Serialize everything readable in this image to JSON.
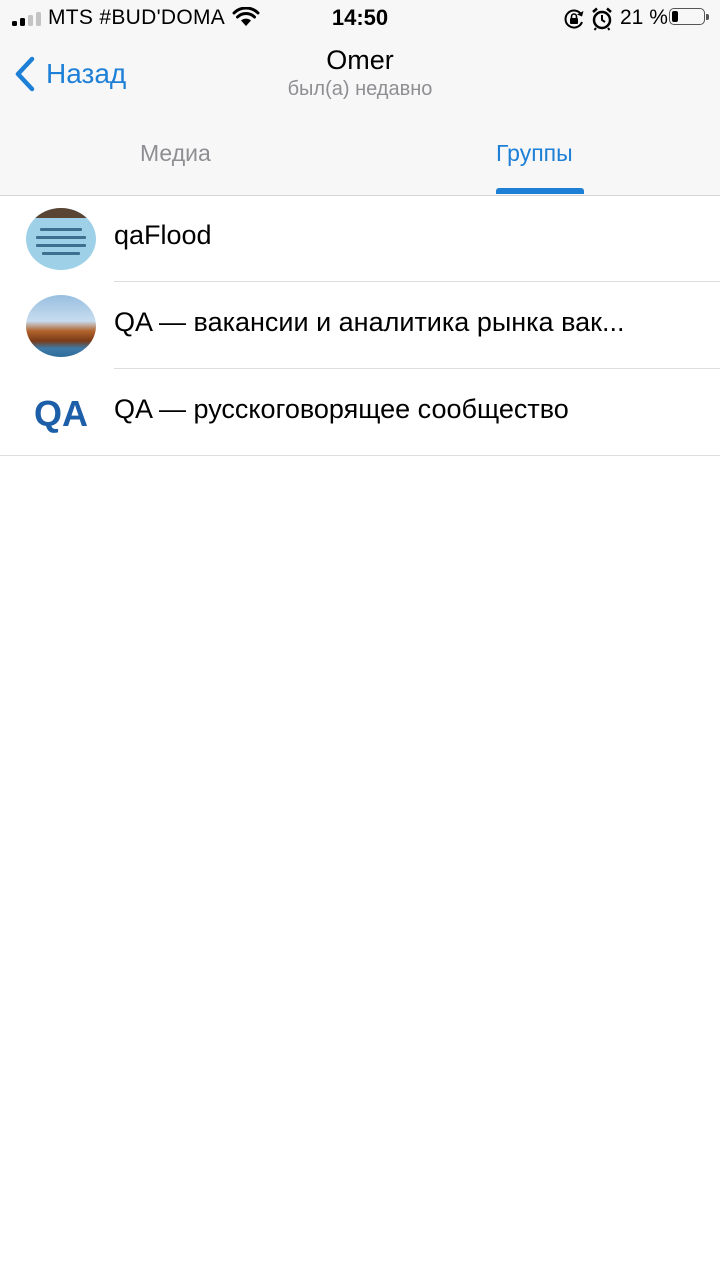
{
  "status_bar": {
    "carrier": "MTS #BUD'DOMA",
    "time": "14:50",
    "battery_percent": "21 %",
    "battery_level": 0.21,
    "signal_bars_filled": 2,
    "signal_bars_total": 4,
    "icons": [
      "signal-icon",
      "wifi-icon",
      "rotation-lock-icon",
      "alarm-icon",
      "battery-icon"
    ]
  },
  "nav": {
    "back_label": "Назад",
    "title": "Omer",
    "subtitle": "был(а) недавно"
  },
  "tabs": [
    {
      "label": "Медиа",
      "selected": false
    },
    {
      "label": "Группы",
      "selected": true
    }
  ],
  "groups": [
    {
      "name": "qaFlood"
    },
    {
      "name": "QA — вакансии и аналитика рынка вак..."
    },
    {
      "name": "QA — русскоговорящее сообщество",
      "avatar_text": "QA"
    }
  ],
  "colors": {
    "accent": "#1d7fd6",
    "secondary_text": "#8e8e93",
    "bar_background": "#f7f7f7",
    "qa_logo": "#1d5ea8"
  }
}
